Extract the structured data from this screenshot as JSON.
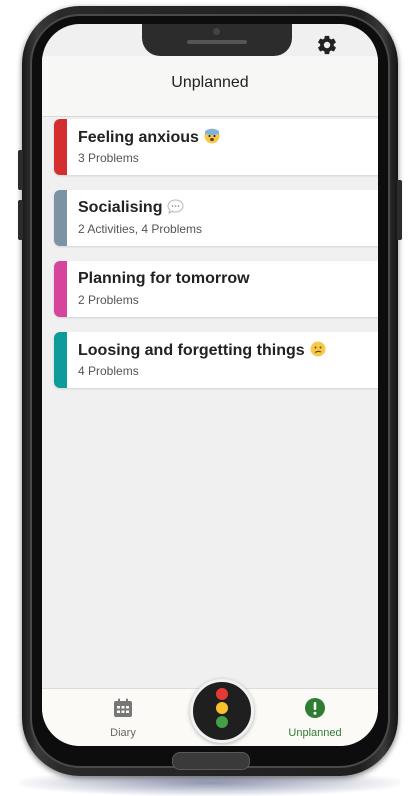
{
  "header": {
    "title": "Unplanned",
    "settings_icon": "gear-icon"
  },
  "cards": [
    {
      "title": "Feeling anxious",
      "subtitle": "3 Problems",
      "color": "#d32f2f",
      "emoji": "anxious-face-icon"
    },
    {
      "title": "Socialising",
      "subtitle": "2 Activities, 4 Problems",
      "color": "#7b93a3",
      "emoji": "speech-bubble-icon"
    },
    {
      "title": "Planning for tomorrow",
      "subtitle": "2 Problems",
      "color": "#d6449b",
      "emoji": ""
    },
    {
      "title": "Loosing and forgetting things",
      "subtitle": "4 Problems",
      "color": "#0e9c9a",
      "emoji": "confused-face-icon"
    }
  ],
  "tabbar": {
    "diary_label": "Diary",
    "unplanned_label": "Unplanned",
    "active_color": "#2e7d32",
    "inactive_color": "#666666",
    "center_icon": "traffic-light-icon"
  }
}
